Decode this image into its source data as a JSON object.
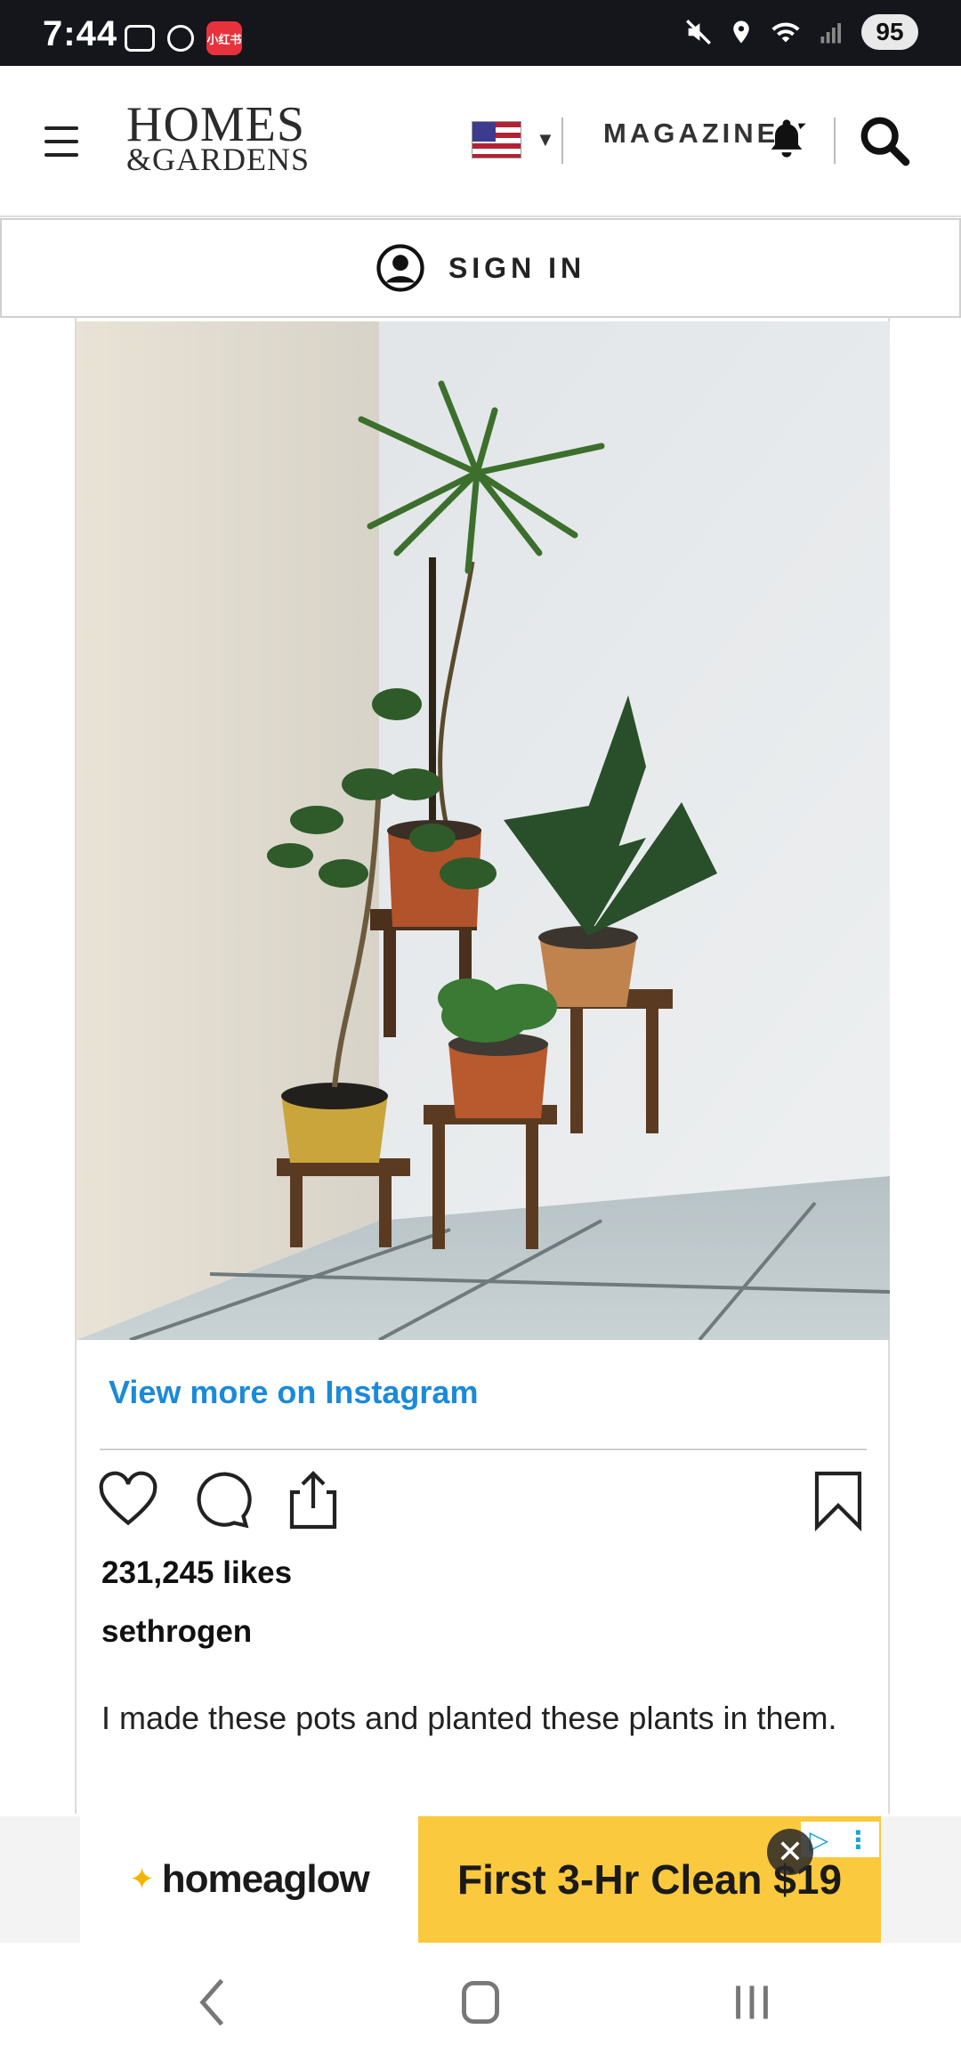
{
  "status_bar": {
    "time": "7:44",
    "app_badge": "小红书",
    "battery": "95",
    "icons": [
      "screenshot-icon",
      "sync-icon",
      "app-icon",
      "mute-icon",
      "location-icon",
      "wifi-icon",
      "signal-icon",
      "battery-icon"
    ]
  },
  "header": {
    "logo_line1": "HOMES",
    "logo_line2": "&GARDENS",
    "region": "US",
    "magazine_label": "MAGAZINE"
  },
  "signin": {
    "label": "SIGN IN"
  },
  "instagram_post": {
    "view_more": "View more on Instagram",
    "likes": "231,245 likes",
    "username": "sethrogen",
    "caption": "I made these pots and planted these plants in them."
  },
  "ad": {
    "brand": "homeaglow",
    "cta": "First 3-Hr Clean $19"
  },
  "colors": {
    "link": "#1b8ad8",
    "status_bar_bg": "#14161c",
    "ad_yellow": "#fbc93d"
  }
}
